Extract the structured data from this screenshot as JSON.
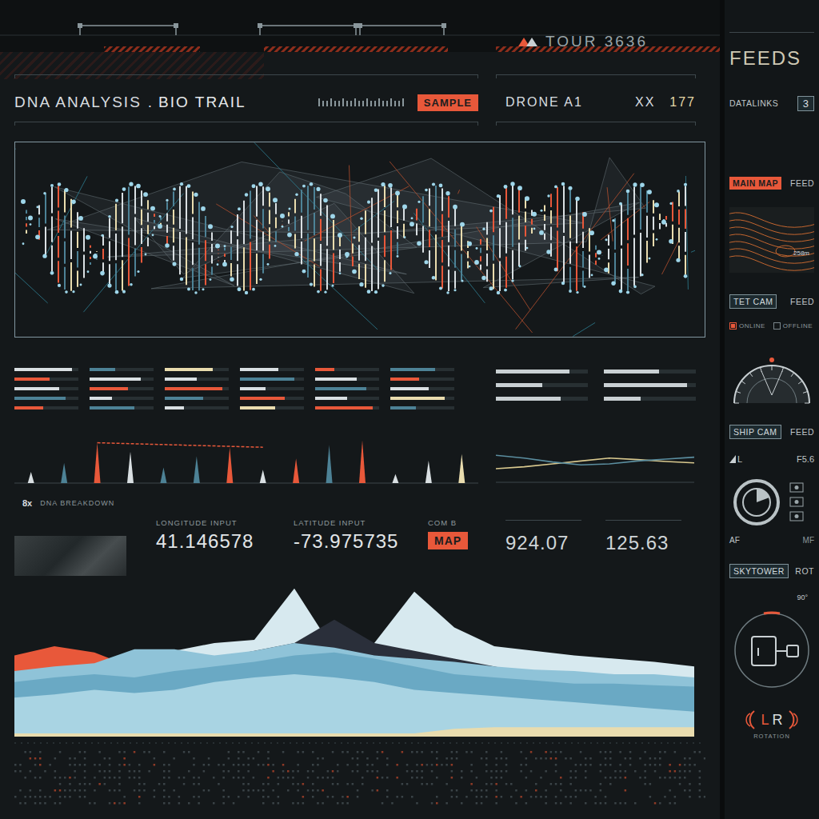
{
  "top_bar": {
    "brand": "TOUR 3636"
  },
  "analysis": {
    "title": "DNA ANALYSIS",
    "separator": ".",
    "subtitle": "BIO TRAIL",
    "badge": "SAMPLE"
  },
  "drone": {
    "label": "DRONE A1",
    "code": "XX",
    "count": "177"
  },
  "sequence_table": {
    "columns": [
      [
        {
          "level": 0.9,
          "color": "#d9dfe2"
        },
        {
          "level": 0.55,
          "color": "#e8583a"
        },
        {
          "level": 0.7,
          "color": "#d9dfe2"
        },
        {
          "level": 0.8,
          "color": "#4d8296"
        },
        {
          "level": 0.45,
          "color": "#e8583a"
        }
      ],
      [
        {
          "level": 0.4,
          "color": "#4d8296"
        },
        {
          "level": 0.8,
          "color": "#d9dfe2"
        },
        {
          "level": 0.6,
          "color": "#e8583a"
        },
        {
          "level": 0.35,
          "color": "#d9dfe2"
        },
        {
          "level": 0.7,
          "color": "#4d8296"
        }
      ],
      [
        {
          "level": 0.75,
          "color": "#e9dcae"
        },
        {
          "level": 0.5,
          "color": "#d9dfe2"
        },
        {
          "level": 0.9,
          "color": "#e8583a"
        },
        {
          "level": 0.6,
          "color": "#4d8296"
        },
        {
          "level": 0.3,
          "color": "#d9dfe2"
        }
      ],
      [
        {
          "level": 0.6,
          "color": "#d9dfe2"
        },
        {
          "level": 0.85,
          "color": "#4d8296"
        },
        {
          "level": 0.4,
          "color": "#d9dfe2"
        },
        {
          "level": 0.7,
          "color": "#e8583a"
        },
        {
          "level": 0.55,
          "color": "#e9dcae"
        }
      ],
      [
        {
          "level": 0.3,
          "color": "#e8583a"
        },
        {
          "level": 0.65,
          "color": "#d9dfe2"
        },
        {
          "level": 0.8,
          "color": "#4d8296"
        },
        {
          "level": 0.5,
          "color": "#d9dfe2"
        },
        {
          "level": 0.9,
          "color": "#e8583a"
        }
      ],
      [
        {
          "level": 0.7,
          "color": "#4d8296"
        },
        {
          "level": 0.45,
          "color": "#e8583a"
        },
        {
          "level": 0.6,
          "color": "#d9dfe2"
        },
        {
          "level": 0.85,
          "color": "#e9dcae"
        },
        {
          "level": 0.4,
          "color": "#4d8296"
        }
      ]
    ]
  },
  "spike_chart": {
    "spikes": [
      {
        "value": 25,
        "color": "#d9dfe2"
      },
      {
        "value": 45,
        "color": "#4d8296"
      },
      {
        "value": 90,
        "color": "#e8583a"
      },
      {
        "value": 70,
        "color": "#d9dfe2"
      },
      {
        "value": 35,
        "color": "#4d8296"
      },
      {
        "value": 60,
        "color": "#4d8296"
      },
      {
        "value": 80,
        "color": "#e8583a"
      },
      {
        "value": 30,
        "color": "#d9dfe2"
      },
      {
        "value": 55,
        "color": "#e8583a"
      },
      {
        "value": 85,
        "color": "#4d8296"
      },
      {
        "value": 95,
        "color": "#e8583a"
      },
      {
        "value": 20,
        "color": "#d9dfe2"
      },
      {
        "value": 50,
        "color": "#d9dfe2"
      },
      {
        "value": 65,
        "color": "#e9dcae"
      }
    ],
    "trend": [
      90,
      88,
      86,
      84,
      82,
      80
    ]
  },
  "side_bars": {
    "rows": [
      [
        0.8,
        0.6
      ],
      [
        0.5,
        0.9
      ],
      [
        0.7,
        0.4
      ]
    ]
  },
  "line_chart": {
    "series": [
      {
        "color": "#d9c98f",
        "values": [
          30,
          34,
          40,
          46,
          52,
          49,
          45,
          42
        ]
      },
      {
        "color": "#5b8ea0",
        "values": [
          58,
          52,
          44,
          38,
          40,
          46,
          50,
          54
        ]
      }
    ]
  },
  "breakdown": {
    "multiplier": "8x",
    "label": "DNA BREAKDOWN"
  },
  "coordinates": {
    "longitude_label": "LONGITUDE INPUT",
    "longitude": "41.146578",
    "latitude_label": "LATITUDE INPUT",
    "latitude": "-73.975735",
    "com_label": "COM B",
    "button": "MAP"
  },
  "readings": [
    "924.07",
    "125.63"
  ],
  "terrain": {
    "layers": [
      {
        "color": "#d7e9ef",
        "values": [
          38,
          42,
          45,
          50,
          55,
          60,
          62,
          95,
          55,
          60,
          93,
          70,
          58,
          55,
          52,
          50,
          48,
          45
        ]
      },
      {
        "color": "#2a2f3a",
        "values": [
          30,
          35,
          40,
          42,
          45,
          50,
          55,
          60,
          75,
          60,
          55,
          50,
          45,
          40,
          38,
          36,
          35,
          34
        ]
      },
      {
        "color": "#e8583a",
        "values": [
          52,
          58,
          54,
          44,
          30,
          30,
          35,
          40,
          50,
          40,
          35,
          30,
          28,
          28,
          27,
          26,
          26,
          25
        ]
      },
      {
        "color": "#8fc3d8",
        "values": [
          42,
          45,
          47,
          56,
          56,
          52,
          55,
          60,
          57,
          52,
          50,
          48,
          45,
          43,
          42,
          40,
          40,
          38
        ]
      },
      {
        "color": "#6aa9c4",
        "values": [
          35,
          38,
          40,
          38,
          42,
          45,
          48,
          52,
          54,
          50,
          45,
          40,
          38,
          36,
          34,
          34,
          33,
          32
        ]
      },
      {
        "color": "#a9d4e3",
        "values": [
          25,
          27,
          30,
          28,
          30,
          35,
          38,
          40,
          38,
          35,
          30,
          28,
          26,
          24,
          22,
          20,
          18,
          16
        ]
      },
      {
        "color": "#e9dcae",
        "values": [
          2,
          2,
          2,
          2,
          2,
          2,
          2,
          2,
          2,
          2,
          2,
          5,
          6,
          6,
          6,
          6,
          6,
          6
        ]
      }
    ]
  },
  "sidebar": {
    "title": "FEEDS",
    "datalinks": {
      "label": "DATALINKS",
      "value": "3"
    },
    "main_map": {
      "label": "MAIN MAP",
      "suffix": "FEED",
      "selected": true
    },
    "map_elevation": "258m",
    "tet_cam": {
      "label": "TET CAM",
      "suffix": "FEED",
      "selected": false
    },
    "status": [
      {
        "label": "ONLINE",
        "on": true,
        "color": "#e8583a"
      },
      {
        "label": "OFFLINE",
        "on": false,
        "color": "#7a858a"
      }
    ],
    "ship_cam": {
      "label": "SHIP CAM",
      "suffix": "FEED",
      "selected": false
    },
    "camera": {
      "mode": "L",
      "aperture": "F5.6",
      "focus_auto": "AF",
      "focus_manual": "MF"
    },
    "skytower": {
      "label": "SKYTOWER",
      "suffix": "ROT",
      "selected": false
    },
    "rotation": {
      "angle": "90°",
      "left": "L",
      "right": "R",
      "label": "ROTATION"
    }
  }
}
